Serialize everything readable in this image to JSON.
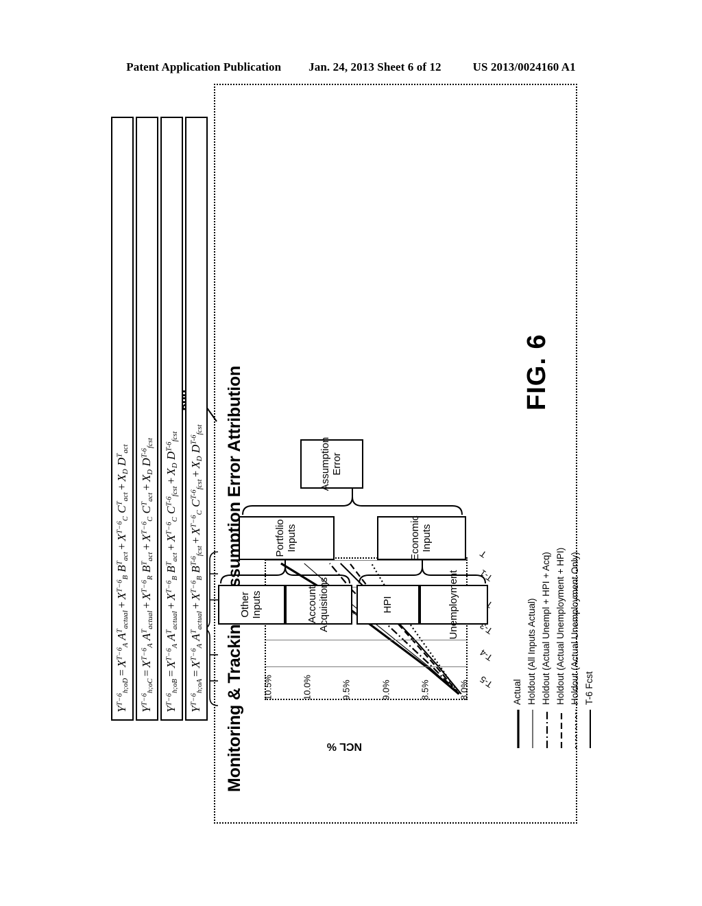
{
  "header": {
    "publication": "Patent Application Publication",
    "date_sheet": "Jan. 24, 2013  Sheet 6 of 12",
    "patent_number": "US 2013/0024160 A1"
  },
  "figure": {
    "caption": "FIG. 6",
    "reference_numeral": "600",
    "title": "Monitoring & Tracking - Assumption Error Attribution"
  },
  "flow": {
    "root": "Assumption Error",
    "groups": [
      {
        "label": "Portfolio Inputs"
      },
      {
        "label": "Economic Inputs"
      }
    ],
    "leaves": [
      {
        "label": "Other Inputs"
      },
      {
        "label": "Account Acquisitions"
      },
      {
        "label": "HPI"
      },
      {
        "label": "Unemployment"
      }
    ]
  },
  "legend": {
    "items": [
      {
        "label": "Actual",
        "style": "solid-thick"
      },
      {
        "label": "Holdout (All Inputs Actual)",
        "style": "solid-thin"
      },
      {
        "label": "Holdout (Actual Unempl + HPI + Acq)",
        "style": "dash-dot"
      },
      {
        "label": "Holdout (Actual Unemployment + HPI)",
        "style": "dashed"
      },
      {
        "label": "Holdout (Actual Unemployment Only)",
        "style": "dotted"
      },
      {
        "label": "T-6 Fcst",
        "style": "solid-medium"
      }
    ]
  },
  "formulas": [
    "Y(T-6, h;oD) = X(T-6, A) A(T, actual) + X(T-6, B) B(T, act) + X(T-6, C) C(T, act) + X(D) D(T, act)",
    "Y(T-6, h;oC) = X(T-6, A) A(T, actual) + X(T-6, R) B(T, act) + X(T-6, C) C(T, act) + X(D) D(T-6, fcst)",
    "Y(T-6, h;oB) = X(T-6, A) A(T, actual) + X(T-6, B) B(T, act) + X(T-6, C) C(T-6, fcst) + X(D) D(T-6, fcst)",
    "Y(T-6, h;oA) = X(T-6, A) A(T, actual) + X(T-6, B) B(T-6, fcst) + X(T-6, C) C(T-6, fcst) + X(D) D(T-6, fcst)"
  ],
  "chart_data": {
    "type": "line",
    "title": "Monitoring & Tracking - Assumption Error Attribution",
    "xlabel": "",
    "ylabel": "NCL %",
    "x": [
      "T-5",
      "T-4",
      "T-3",
      "T-2",
      "T-1",
      "T"
    ],
    "ytick_labels": [
      "8.0%",
      "8.5%",
      "9.0%",
      "9.5%",
      "10.0%",
      "10.5%"
    ],
    "ylim": [
      8.0,
      10.5
    ],
    "grid": true,
    "legend_position": "below-left",
    "series": [
      {
        "name": "Actual",
        "style": "solid-thick",
        "values": [
          8.05,
          8.45,
          8.9,
          9.35,
          9.8,
          10.35
        ]
      },
      {
        "name": "Holdout (All Inputs Actual)",
        "style": "solid-thin",
        "values": [
          8.05,
          8.42,
          8.84,
          9.26,
          9.66,
          10.05
        ]
      },
      {
        "name": "Holdout (Actual Unempl + HPI + Acq)",
        "style": "dash-dot",
        "values": [
          8.05,
          8.38,
          8.74,
          9.1,
          9.44,
          9.72
        ]
      },
      {
        "name": "Holdout (Actual Unemployment + HPI)",
        "style": "dashed",
        "values": [
          8.05,
          8.33,
          8.63,
          8.93,
          9.2,
          9.46
        ]
      },
      {
        "name": "Holdout (Actual Unemployment Only)",
        "style": "dotted",
        "values": [
          8.05,
          8.28,
          8.52,
          8.76,
          8.98,
          9.18
        ]
      },
      {
        "name": "T-6 Fcst",
        "style": "solid-medium",
        "values": [
          8.02,
          8.3,
          8.6,
          8.92,
          9.24,
          9.58
        ]
      }
    ]
  }
}
